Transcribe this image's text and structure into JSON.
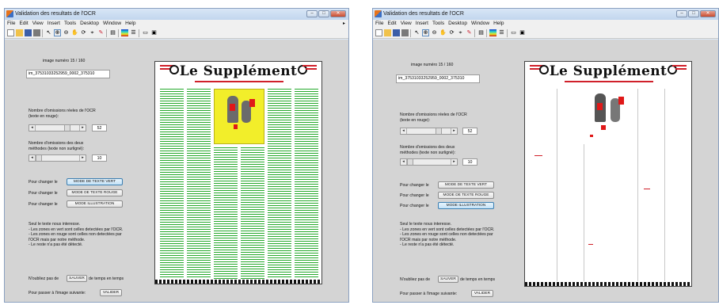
{
  "window": {
    "title": "Validation des resultats de l'OCR",
    "controls": {
      "minimize": "–",
      "maximize": "□",
      "close": "✕"
    }
  },
  "menu": [
    "File",
    "Edit",
    "View",
    "Insert",
    "Tools",
    "Desktop",
    "Window",
    "Help"
  ],
  "toolbar_icons": [
    "new-icon",
    "open-icon",
    "save-icon",
    "print-icon",
    "pointer-icon",
    "zoom-in-icon",
    "zoom-out-icon",
    "pan-icon",
    "rotate-icon",
    "data-cursor-icon",
    "brush-icon",
    "link-icon",
    "colorbar-icon",
    "legend-icon",
    "hide-tools-icon",
    "show-tools-icon"
  ],
  "panel": {
    "image_counter": "image numéro 15 / 160",
    "filename": "im_37531033252959_0002_375310",
    "omissions_ocr_label": "Nombre d'omissions réeles de l'OCR\n(texte en rouge):",
    "omissions_ocr_value": "52",
    "omissions_both_label": "Nombre d'omissions des deux\nméthodes (texte non surligné):",
    "omissions_both_value": "10",
    "change_prefix": "Pour changer le",
    "mode_green_button": "MODE DE TEXTE VERT",
    "mode_red_button": "MODE DE TEXTE ROUGE",
    "mode_illustration_button": "MODE ILLUSTRATION",
    "info": "Seul le texte nous interesse.\n- Les zones en vert sont celles detectées par l'OCR.\n- Les zones en rouge sont celles non detectées par\nl'OCR mais par notre méthode.\n- Le reste n'a pas été détecté.",
    "save_prefix": "N'oubliez pas de",
    "save_button": "SAUVER",
    "save_suffix": "de temps en temps",
    "next_label": "Pour passer à l'image suivante:",
    "validate_button": "VALIDER"
  },
  "newspaper": {
    "title": "Le Supplément"
  },
  "views": [
    {
      "name": "green-text-mode",
      "active_mode": "green"
    },
    {
      "name": "illustration-mode",
      "active_mode": "illustration"
    }
  ],
  "colors": {
    "ocr_detected": "#25a92b",
    "method_detected": "#e01818",
    "illustration": "#f2ee2a",
    "active_button": "#c4e2f7"
  }
}
